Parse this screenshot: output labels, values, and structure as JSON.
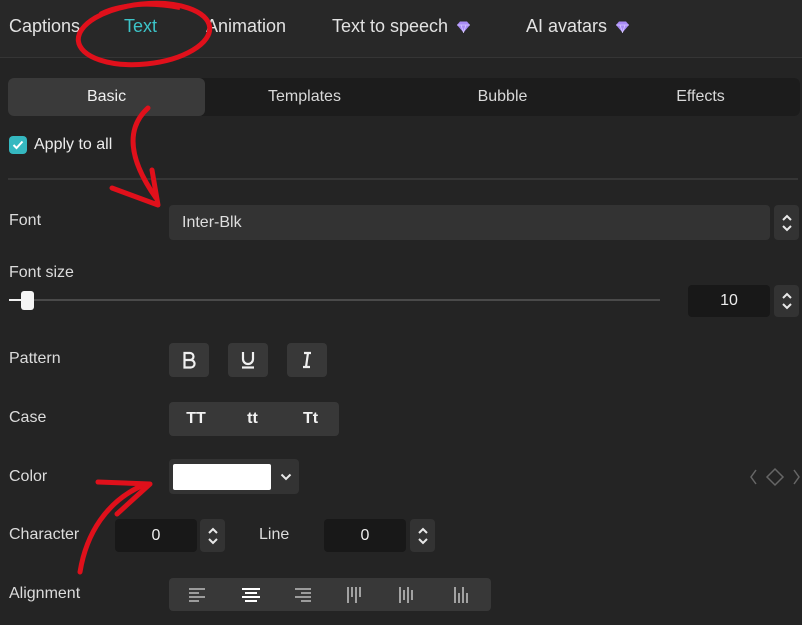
{
  "top_tabs": [
    {
      "label": "Captions"
    },
    {
      "label": "Text"
    },
    {
      "label": "Animation"
    },
    {
      "label": "Text to speech"
    },
    {
      "label": "AI avatars"
    }
  ],
  "sub_tabs": [
    {
      "label": "Basic"
    },
    {
      "label": "Templates"
    },
    {
      "label": "Bubble"
    },
    {
      "label": "Effects"
    }
  ],
  "apply_to_all": {
    "label": "Apply to all",
    "checked": true
  },
  "font": {
    "label": "Font",
    "value": "Inter-Blk"
  },
  "font_size": {
    "label": "Font size",
    "value": "10",
    "slider_level": 0.02
  },
  "pattern": {
    "label": "Pattern",
    "buttons": [
      "bold-icon",
      "underline-icon",
      "italic-icon"
    ]
  },
  "case": {
    "label": "Case",
    "options": [
      "TT",
      "tt",
      "Tt"
    ]
  },
  "color": {
    "label": "Color",
    "value": "#ffffff"
  },
  "character": {
    "label": "Character",
    "value": "0"
  },
  "line": {
    "label": "Line",
    "value": "0"
  },
  "alignment": {
    "label": "Alignment",
    "options": [
      "align-left-icon",
      "align-center-icon",
      "align-right-icon",
      "align-top-icon",
      "align-middle-icon",
      "align-bottom-icon"
    ]
  },
  "colors": {
    "accent": "#3cc4c8",
    "premium": "#a98bf7",
    "annotation": "#e0101b"
  }
}
